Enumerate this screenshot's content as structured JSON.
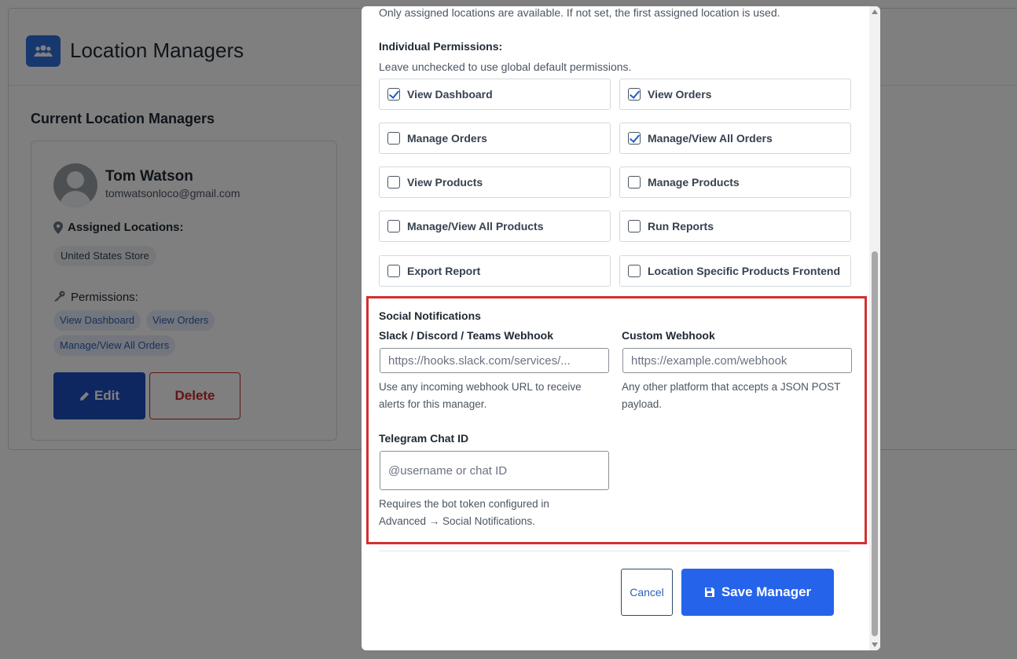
{
  "page": {
    "title": "Location Managers",
    "section_title": "Current Location Managers"
  },
  "manager": {
    "name": "Tom Watson",
    "email": "tomwatsonloco@gmail.com",
    "assigned_label": "Assigned Locations:",
    "locations": [
      "United States Store"
    ],
    "permissions_label": "Permissions:",
    "permissions": [
      "View Dashboard",
      "View Orders",
      "Manage/View All Orders"
    ],
    "edit_label": "Edit",
    "delete_label": "Delete"
  },
  "modal": {
    "location_help": "Only assigned locations are available. If not set, the first assigned location is used.",
    "individual_title": "Individual Permissions:",
    "individual_help": "Leave unchecked to use global default permissions.",
    "perms": [
      {
        "label": "View Dashboard",
        "checked": true
      },
      {
        "label": "View Orders",
        "checked": true
      },
      {
        "label": "Manage Orders",
        "checked": false
      },
      {
        "label": "Manage/View All Orders",
        "checked": true
      },
      {
        "label": "View Products",
        "checked": false
      },
      {
        "label": "Manage Products",
        "checked": false
      },
      {
        "label": "Manage/View All Products",
        "checked": false
      },
      {
        "label": "Run Reports",
        "checked": false
      },
      {
        "label": "Export Report",
        "checked": false
      },
      {
        "label": "Location Specific Products Frontend",
        "checked": false
      }
    ],
    "social": {
      "title": "Social Notifications",
      "slack_label": "Slack / Discord / Teams Webhook",
      "slack_placeholder": "https://hooks.slack.com/services/...",
      "slack_help": "Use any incoming webhook URL to receive alerts for this manager.",
      "custom_label": "Custom Webhook",
      "custom_placeholder": "https://example.com/webhook",
      "custom_help": "Any other platform that accepts a JSON POST payload.",
      "telegram_label": "Telegram Chat ID",
      "telegram_placeholder": "@username or chat ID",
      "telegram_help": "Requires the bot token configured in Advanced → Social Notifications."
    },
    "cancel_label": "Cancel",
    "save_label": "Save Manager"
  },
  "colors": {
    "primary": "#2563eb",
    "edit_button": "#1f4fc0",
    "danger": "#c62828",
    "highlight": "#d32f2f"
  }
}
